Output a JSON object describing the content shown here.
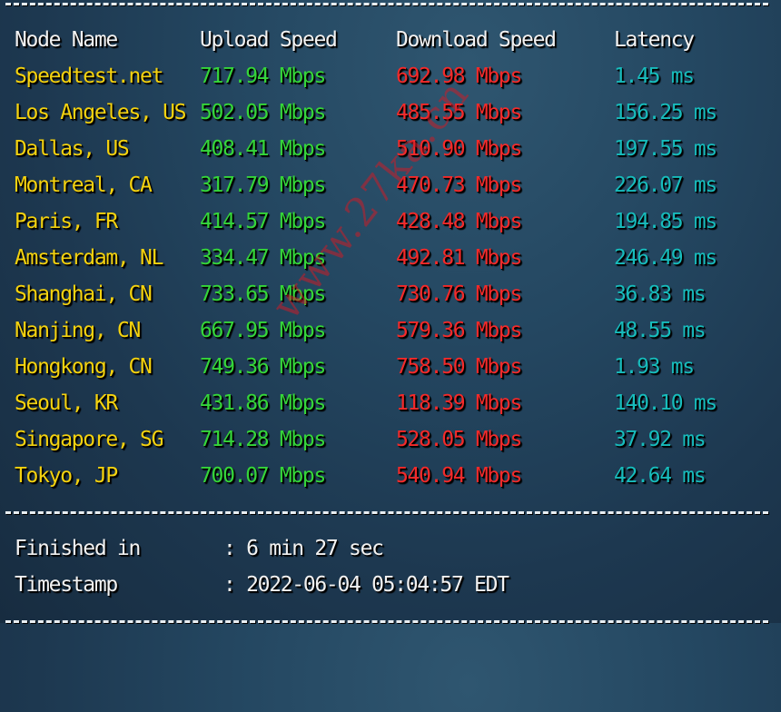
{
  "table": {
    "headers": [
      "Node Name",
      "Upload Speed",
      "Download Speed",
      "Latency"
    ],
    "rows": [
      {
        "node": "Speedtest.net",
        "upload": "717.94 Mbps",
        "download": "692.98 Mbps",
        "latency": "1.45 ms"
      },
      {
        "node": "Los Angeles, US",
        "upload": "502.05 Mbps",
        "download": "485.55 Mbps",
        "latency": "156.25 ms"
      },
      {
        "node": "Dallas, US",
        "upload": "408.41 Mbps",
        "download": "510.90 Mbps",
        "latency": "197.55 ms"
      },
      {
        "node": "Montreal, CA",
        "upload": "317.79 Mbps",
        "download": "470.73 Mbps",
        "latency": "226.07 ms"
      },
      {
        "node": "Paris, FR",
        "upload": "414.57 Mbps",
        "download": "428.48 Mbps",
        "latency": "194.85 ms"
      },
      {
        "node": "Amsterdam, NL",
        "upload": "334.47 Mbps",
        "download": "492.81 Mbps",
        "latency": "246.49 ms"
      },
      {
        "node": "Shanghai, CN",
        "upload": "733.65 Mbps",
        "download": "730.76 Mbps",
        "latency": "36.83 ms"
      },
      {
        "node": "Nanjing, CN",
        "upload": "667.95 Mbps",
        "download": "579.36 Mbps",
        "latency": "48.55 ms"
      },
      {
        "node": "Hongkong, CN",
        "upload": "749.36 Mbps",
        "download": "758.50 Mbps",
        "latency": "1.93 ms"
      },
      {
        "node": "Seoul, KR",
        "upload": "431.86 Mbps",
        "download": "118.39 Mbps",
        "latency": "140.10 ms"
      },
      {
        "node": "Singapore, SG",
        "upload": "714.28 Mbps",
        "download": "528.05 Mbps",
        "latency": "37.92 ms"
      },
      {
        "node": "Tokyo, JP",
        "upload": "700.07 Mbps",
        "download": "540.94 Mbps",
        "latency": "42.64 ms"
      }
    ]
  },
  "summary": {
    "finished_label": "Finished in",
    "finished_value": ": 6 min 27 sec",
    "timestamp_label": "Timestamp",
    "timestamp_value": ": 2022-06-04 05:04:57 EDT"
  },
  "watermark": "www.27ka.cn",
  "colors": {
    "node": "#f4d20f",
    "upload": "#35d63a",
    "download": "#f42a2a",
    "latency": "#17bcbc"
  }
}
